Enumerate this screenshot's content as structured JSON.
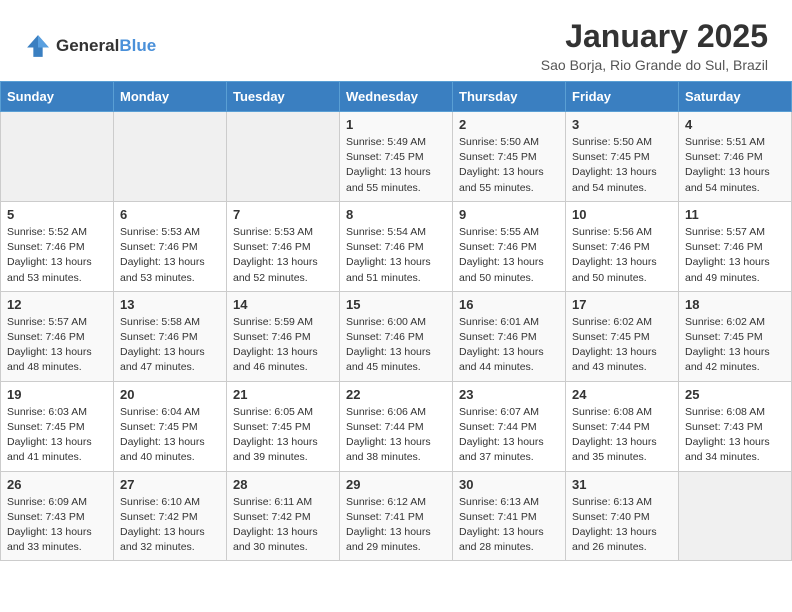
{
  "header": {
    "logo_general": "General",
    "logo_blue": "Blue",
    "title": "January 2025",
    "subtitle": "Sao Borja, Rio Grande do Sul, Brazil"
  },
  "days_of_week": [
    "Sunday",
    "Monday",
    "Tuesday",
    "Wednesday",
    "Thursday",
    "Friday",
    "Saturday"
  ],
  "weeks": [
    [
      {
        "day": "",
        "info": ""
      },
      {
        "day": "",
        "info": ""
      },
      {
        "day": "",
        "info": ""
      },
      {
        "day": "1",
        "info": "Sunrise: 5:49 AM\nSunset: 7:45 PM\nDaylight: 13 hours\nand 55 minutes."
      },
      {
        "day": "2",
        "info": "Sunrise: 5:50 AM\nSunset: 7:45 PM\nDaylight: 13 hours\nand 55 minutes."
      },
      {
        "day": "3",
        "info": "Sunrise: 5:50 AM\nSunset: 7:45 PM\nDaylight: 13 hours\nand 54 minutes."
      },
      {
        "day": "4",
        "info": "Sunrise: 5:51 AM\nSunset: 7:46 PM\nDaylight: 13 hours\nand 54 minutes."
      }
    ],
    [
      {
        "day": "5",
        "info": "Sunrise: 5:52 AM\nSunset: 7:46 PM\nDaylight: 13 hours\nand 53 minutes."
      },
      {
        "day": "6",
        "info": "Sunrise: 5:53 AM\nSunset: 7:46 PM\nDaylight: 13 hours\nand 53 minutes."
      },
      {
        "day": "7",
        "info": "Sunrise: 5:53 AM\nSunset: 7:46 PM\nDaylight: 13 hours\nand 52 minutes."
      },
      {
        "day": "8",
        "info": "Sunrise: 5:54 AM\nSunset: 7:46 PM\nDaylight: 13 hours\nand 51 minutes."
      },
      {
        "day": "9",
        "info": "Sunrise: 5:55 AM\nSunset: 7:46 PM\nDaylight: 13 hours\nand 50 minutes."
      },
      {
        "day": "10",
        "info": "Sunrise: 5:56 AM\nSunset: 7:46 PM\nDaylight: 13 hours\nand 50 minutes."
      },
      {
        "day": "11",
        "info": "Sunrise: 5:57 AM\nSunset: 7:46 PM\nDaylight: 13 hours\nand 49 minutes."
      }
    ],
    [
      {
        "day": "12",
        "info": "Sunrise: 5:57 AM\nSunset: 7:46 PM\nDaylight: 13 hours\nand 48 minutes."
      },
      {
        "day": "13",
        "info": "Sunrise: 5:58 AM\nSunset: 7:46 PM\nDaylight: 13 hours\nand 47 minutes."
      },
      {
        "day": "14",
        "info": "Sunrise: 5:59 AM\nSunset: 7:46 PM\nDaylight: 13 hours\nand 46 minutes."
      },
      {
        "day": "15",
        "info": "Sunrise: 6:00 AM\nSunset: 7:46 PM\nDaylight: 13 hours\nand 45 minutes."
      },
      {
        "day": "16",
        "info": "Sunrise: 6:01 AM\nSunset: 7:46 PM\nDaylight: 13 hours\nand 44 minutes."
      },
      {
        "day": "17",
        "info": "Sunrise: 6:02 AM\nSunset: 7:45 PM\nDaylight: 13 hours\nand 43 minutes."
      },
      {
        "day": "18",
        "info": "Sunrise: 6:02 AM\nSunset: 7:45 PM\nDaylight: 13 hours\nand 42 minutes."
      }
    ],
    [
      {
        "day": "19",
        "info": "Sunrise: 6:03 AM\nSunset: 7:45 PM\nDaylight: 13 hours\nand 41 minutes."
      },
      {
        "day": "20",
        "info": "Sunrise: 6:04 AM\nSunset: 7:45 PM\nDaylight: 13 hours\nand 40 minutes."
      },
      {
        "day": "21",
        "info": "Sunrise: 6:05 AM\nSunset: 7:45 PM\nDaylight: 13 hours\nand 39 minutes."
      },
      {
        "day": "22",
        "info": "Sunrise: 6:06 AM\nSunset: 7:44 PM\nDaylight: 13 hours\nand 38 minutes."
      },
      {
        "day": "23",
        "info": "Sunrise: 6:07 AM\nSunset: 7:44 PM\nDaylight: 13 hours\nand 37 minutes."
      },
      {
        "day": "24",
        "info": "Sunrise: 6:08 AM\nSunset: 7:44 PM\nDaylight: 13 hours\nand 35 minutes."
      },
      {
        "day": "25",
        "info": "Sunrise: 6:08 AM\nSunset: 7:43 PM\nDaylight: 13 hours\nand 34 minutes."
      }
    ],
    [
      {
        "day": "26",
        "info": "Sunrise: 6:09 AM\nSunset: 7:43 PM\nDaylight: 13 hours\nand 33 minutes."
      },
      {
        "day": "27",
        "info": "Sunrise: 6:10 AM\nSunset: 7:42 PM\nDaylight: 13 hours\nand 32 minutes."
      },
      {
        "day": "28",
        "info": "Sunrise: 6:11 AM\nSunset: 7:42 PM\nDaylight: 13 hours\nand 30 minutes."
      },
      {
        "day": "29",
        "info": "Sunrise: 6:12 AM\nSunset: 7:41 PM\nDaylight: 13 hours\nand 29 minutes."
      },
      {
        "day": "30",
        "info": "Sunrise: 6:13 AM\nSunset: 7:41 PM\nDaylight: 13 hours\nand 28 minutes."
      },
      {
        "day": "31",
        "info": "Sunrise: 6:13 AM\nSunset: 7:40 PM\nDaylight: 13 hours\nand 26 minutes."
      },
      {
        "day": "",
        "info": ""
      }
    ]
  ]
}
